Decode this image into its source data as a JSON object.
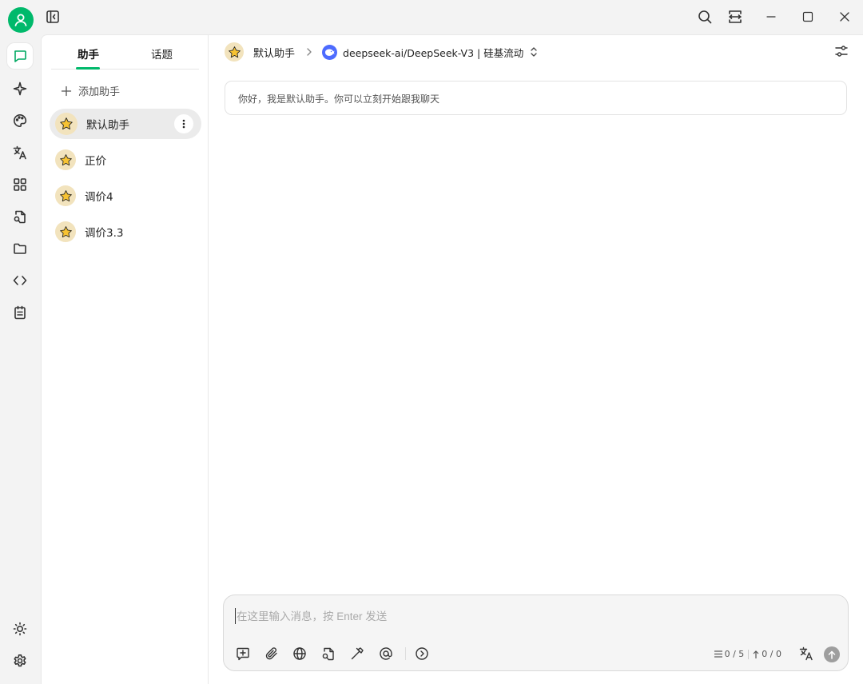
{
  "theme": {
    "accent": "#00b96b",
    "assistant_avatar_bg": "#f2e3bd",
    "model_logo_bg": "#4d6bfe"
  },
  "titlebar": {
    "icons": [
      "user-icon",
      "sidebar-toggle-icon",
      "search-icon",
      "narrow-mode-icon",
      "minimize-icon",
      "maximize-icon",
      "close-icon"
    ]
  },
  "rail": {
    "items": [
      "chat-icon",
      "sparkle-icon",
      "palette-icon",
      "translate-icon",
      "apps-icon",
      "file-search-icon",
      "folder-icon",
      "code-icon",
      "clipboard-icon"
    ],
    "bottom": [
      "sun-icon",
      "gear-icon"
    ]
  },
  "panel": {
    "tabs": [
      {
        "label": "助手"
      },
      {
        "label": "话题"
      }
    ],
    "add_label": "添加助手",
    "assistants": [
      {
        "name": "默认助手",
        "emoji": "⭐"
      },
      {
        "name": "正价",
        "emoji": "⭐"
      },
      {
        "name": "调价4",
        "emoji": "⭐"
      },
      {
        "name": "调价3.3",
        "emoji": "⭐"
      }
    ]
  },
  "main": {
    "assistant_name": "默认助手",
    "model_label": "deepseek-ai/DeepSeek-V3 | 硅基流动",
    "welcome_text": "你好，我是默认助手。你可以立刻开始跟我聊天",
    "composer": {
      "placeholder": "在这里输入消息，按 Enter 发送",
      "context_count": "0 / 5",
      "token_count": "0 / 0"
    }
  }
}
